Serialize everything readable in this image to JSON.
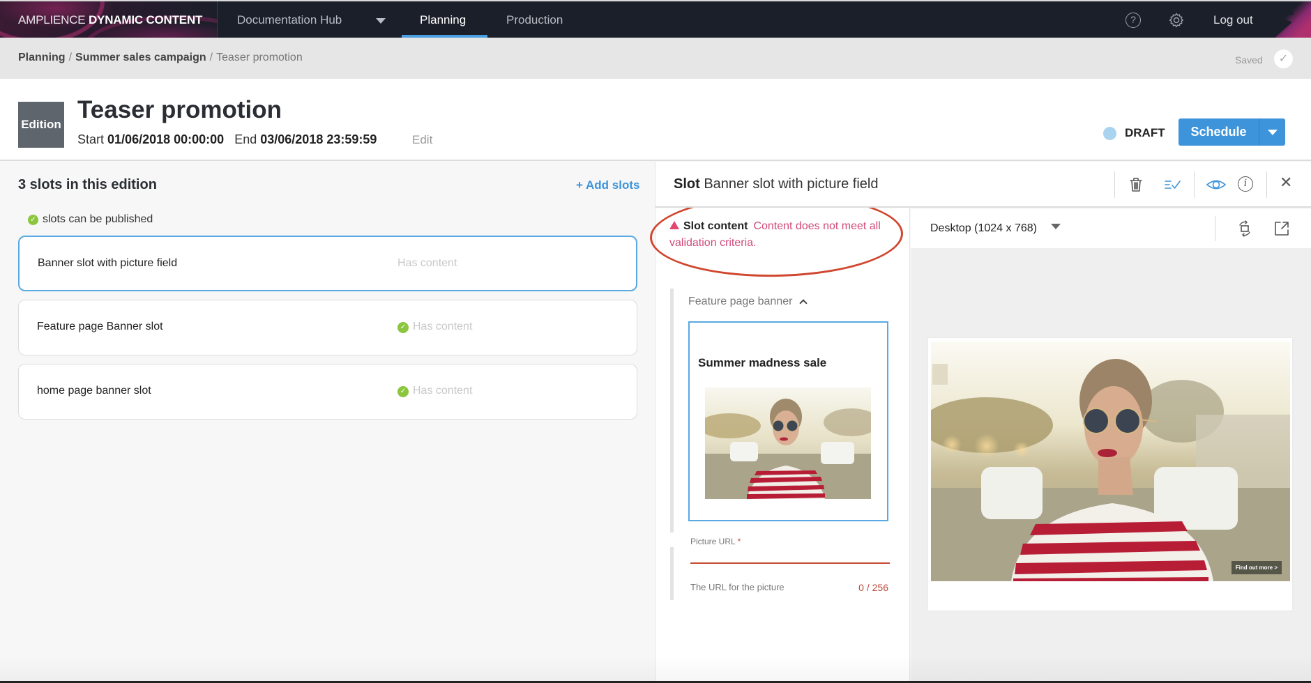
{
  "app": {
    "brand_light": "AMPLIENCE",
    "brand_bold": "DYNAMIC CONTENT"
  },
  "nav": {
    "hub": "Documentation Hub",
    "tabs": [
      {
        "label": "Planning",
        "active": true
      },
      {
        "label": "Production",
        "active": false
      }
    ],
    "logout": "Log out",
    "accent_color": "#4a9fe0"
  },
  "breadcrumb": {
    "items": [
      "Planning",
      "Summer sales campaign",
      "Teaser promotion"
    ],
    "separator": "/",
    "saved": "Saved"
  },
  "edition": {
    "badge": "Edition",
    "title": "Teaser promotion",
    "start_label": "Start",
    "start": "01/06/2018 00:00:00",
    "end_label": "End",
    "end": "03/06/2018 23:59:59",
    "edit": "Edit",
    "status": "DRAFT",
    "schedule": "Schedule"
  },
  "slots": {
    "heading": "3 slots in this edition",
    "add": "+ Add slots",
    "publish_status": "slots can be published",
    "items": [
      {
        "name": "Banner slot with picture field",
        "status": "Has content",
        "valid": false,
        "selected": true
      },
      {
        "name": "Feature page Banner slot",
        "status": "Has content",
        "valid": true,
        "selected": false
      },
      {
        "name": "home page banner slot",
        "status": "Has content",
        "valid": true,
        "selected": false
      }
    ]
  },
  "slot_detail": {
    "prefix": "Slot",
    "name": "Banner slot with picture field",
    "validation_label": "Slot content",
    "validation_message": "Content does not meet all validation criteria.",
    "content_type": "Feature page banner",
    "banner_heading": "Summer madness sale",
    "field": {
      "label": "Picture URL",
      "required_mark": "*",
      "value": "",
      "help": "The URL for the picture",
      "count": "0 / 256"
    }
  },
  "preview": {
    "device": "Desktop (1024 x 768)",
    "cta": "Find out more >"
  }
}
